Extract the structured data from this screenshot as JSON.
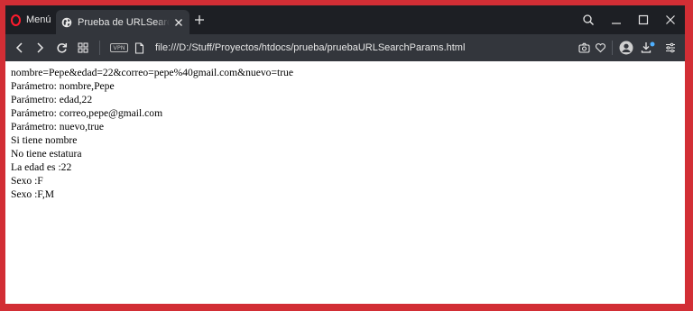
{
  "browser": {
    "menu_label": "Menú",
    "tab_title": "Prueba de URLSearchParams",
    "url": "file:///D:/Stuff/Proyectos/htdocs/prueba/pruebaURLSearchParams.html",
    "vpn_label": "VPN"
  },
  "content": {
    "lines": [
      "nombre=Pepe&edad=22&correo=pepe%40gmail.com&nuevo=true",
      "Parámetro: nombre,Pepe",
      "Parámetro: edad,22",
      "Parámetro: correo,pepe@gmail.com",
      "Parámetro: nuevo,true",
      "Si tiene nombre",
      "No tiene estatura",
      "La edad es :22",
      "Sexo :F",
      "Sexo :F,M"
    ]
  },
  "colors": {
    "frame": "#d22e35",
    "tabbar": "#1d1f24",
    "toolbar": "#33363c",
    "opera_red": "#ff1b2d",
    "download_dot": "#4fb0ff"
  },
  "icons": [
    "opera-logo-icon",
    "globe-icon",
    "close-tab-icon",
    "new-tab-icon",
    "search-tabs-icon",
    "minimize-icon",
    "maximize-icon",
    "close-window-icon",
    "back-icon",
    "forward-icon",
    "reload-icon",
    "speed-dial-icon",
    "vpn-badge-icon",
    "file-icon",
    "snapshot-icon",
    "heart-icon",
    "profile-icon",
    "download-icon",
    "easy-setup-icon"
  ]
}
